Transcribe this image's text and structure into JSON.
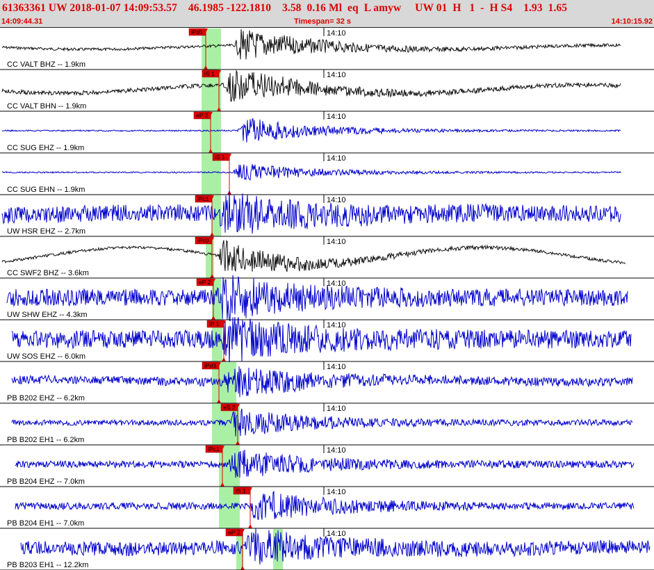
{
  "header": {
    "title": "61363361 UW 2018-01-07 14:09:53.57    46.1985 -122.1810    3.58  0.16 Ml  eq  L amyw     UW 01  H   1  -  H S4    1.93  1.65",
    "start_time": "14:09:44.31",
    "timespan": "Timespan=  32 s",
    "end_time": "14:10:15.92"
  },
  "colors": {
    "header_bg": "#d8d8d8",
    "header_text": "#dd0000",
    "trace_blue": "#0000cc",
    "trace_black": "#111111",
    "pick_red": "#dd0000",
    "window_green": "#aaf0a4"
  },
  "tick_time_label": "14:10",
  "channels": [
    {
      "label": "CC VALT BHZ -- 1.9km",
      "pick": "iPd1",
      "color": "black"
    },
    {
      "label": "CC VALT BHN -- 1.9km",
      "pick": "iS 1",
      "color": "black"
    },
    {
      "label": "CC SUG EHZ -- 1.9km",
      "pick": "eP 2",
      "color": "blue"
    },
    {
      "label": "CC SUG EHN -- 1.9km",
      "pick": "iS 1",
      "color": "blue"
    },
    {
      "label": "UW HSR EHZ -- 2.7km",
      "pick": "iPc1",
      "color": "blue"
    },
    {
      "label": "CC SWF2 BHZ -- 3.6km",
      "pick": "iPc0",
      "color": "black"
    },
    {
      "label": "UW SHW EHZ -- 4.3km",
      "pick": "eP 2",
      "color": "blue"
    },
    {
      "label": "UW SOS EHZ -- 6.0km",
      "pick": "iP 1",
      "color": "blue"
    },
    {
      "label": "PB B202 EHZ -- 6.2km",
      "pick": "iPd3",
      "color": "blue"
    },
    {
      "label": "PB B202 EH1 -- 6.2km",
      "pick": "eS 2",
      "color": "blue"
    },
    {
      "label": "PB B204 EHZ -- 7.0km",
      "pick": "iPc1",
      "color": "blue"
    },
    {
      "label": "PB B204 EH1 -- 7.0km",
      "pick": "iS 1",
      "color": "blue"
    },
    {
      "label": "PB B203 EH1 -- 12.2km",
      "pick": "eP 2",
      "color": "blue"
    }
  ]
}
